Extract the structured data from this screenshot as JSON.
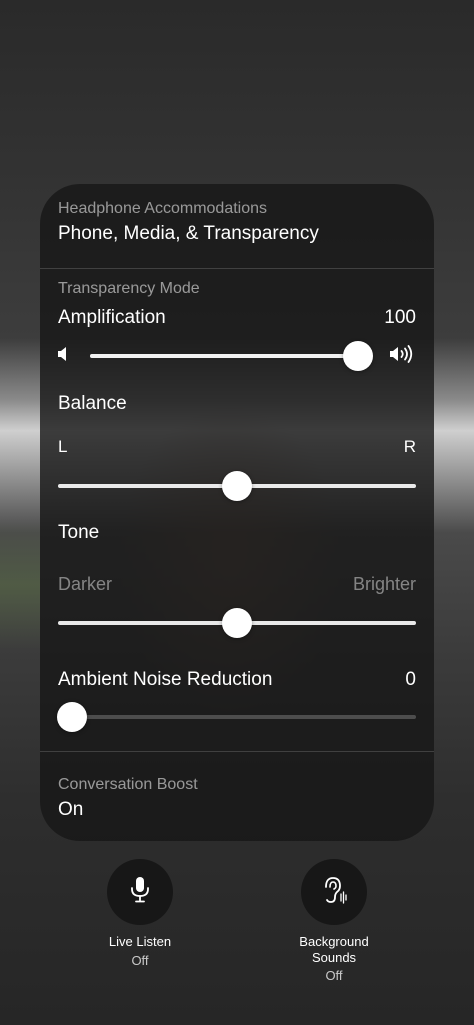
{
  "header": {
    "label": "Headphone Accommodations",
    "value": "Phone, Media, & Transparency"
  },
  "transparency": {
    "section_label": "Transparency Mode",
    "amplification": {
      "label": "Amplification",
      "value": "100",
      "level": 1.0
    },
    "balance": {
      "label": "Balance",
      "left": "L",
      "right": "R",
      "level": 0.5
    },
    "tone": {
      "label": "Tone",
      "left": "Darker",
      "right": "Brighter",
      "level": 0.5
    },
    "noise_reduction": {
      "label": "Ambient Noise Reduction",
      "value": "0",
      "level": 0.0
    }
  },
  "conversation_boost": {
    "label": "Conversation Boost",
    "value": "On"
  },
  "controls": {
    "live_listen": {
      "icon": "microphone-icon",
      "label": "Live Listen",
      "state": "Off"
    },
    "background_sounds": {
      "icon": "ear-icon",
      "label": "Background Sounds",
      "state": "Off"
    }
  }
}
